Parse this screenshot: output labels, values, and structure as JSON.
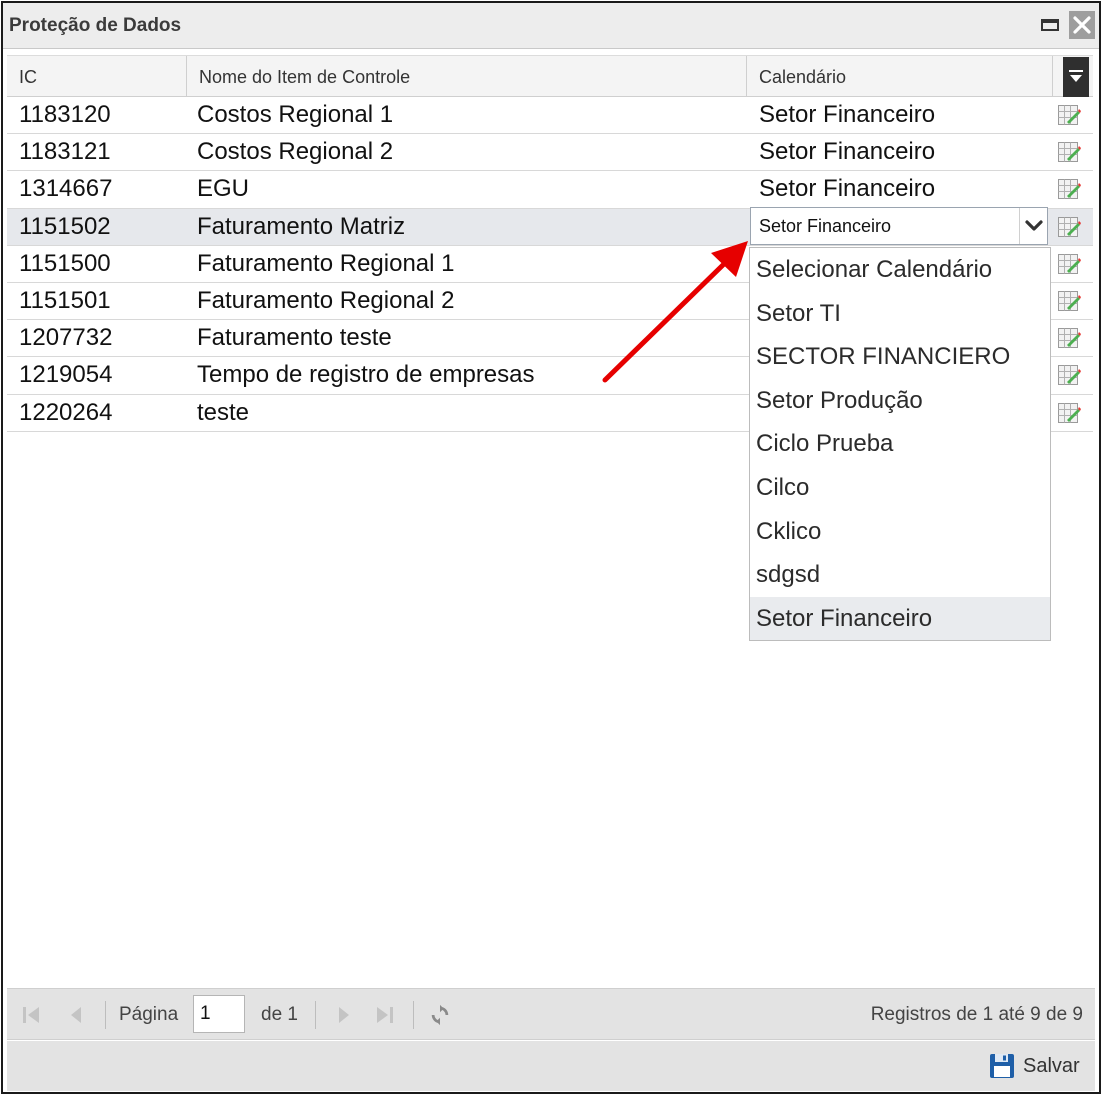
{
  "window": {
    "title": "Proteção de Dados"
  },
  "grid": {
    "columns": [
      "IC",
      "Nome do Item de Controle",
      "Calendário"
    ],
    "rows": [
      {
        "ic": "1183120",
        "name": "Costos Regional 1",
        "calendar": "Setor Financeiro"
      },
      {
        "ic": "1183121",
        "name": "Costos Regional 2",
        "calendar": "Setor Financeiro"
      },
      {
        "ic": "1314667",
        "name": "EGU",
        "calendar": "Setor Financeiro"
      },
      {
        "ic": "1151502",
        "name": "Faturamento Matriz",
        "calendar": ""
      },
      {
        "ic": "1151500",
        "name": "Faturamento Regional 1",
        "calendar": ""
      },
      {
        "ic": "1151501",
        "name": "Faturamento Regional 2",
        "calendar": ""
      },
      {
        "ic": "1207732",
        "name": "Faturamento teste",
        "calendar": ""
      },
      {
        "ic": "1219054",
        "name": "Tempo de registro de empresas",
        "calendar": ""
      },
      {
        "ic": "1220264",
        "name": "teste",
        "calendar": ""
      }
    ]
  },
  "dropdown": {
    "selected_value": "Setor Financeiro",
    "options": [
      "Selecionar Calendário",
      "Setor TI",
      "SECTOR FINANCIERO",
      "Setor Produção",
      "Ciclo Prueba",
      "Cilco",
      "Cklico",
      "sdgsd",
      "Setor Financeiro"
    ]
  },
  "pager": {
    "page_label": "Página",
    "page_value": "1",
    "of_label": "de 1",
    "records_text": "Registros de 1 até 9 de 9"
  },
  "footer": {
    "save_label": "Salvar"
  },
  "colors": {
    "annotation_arrow": "#e60000",
    "selected_row": "#e6e8ec"
  }
}
